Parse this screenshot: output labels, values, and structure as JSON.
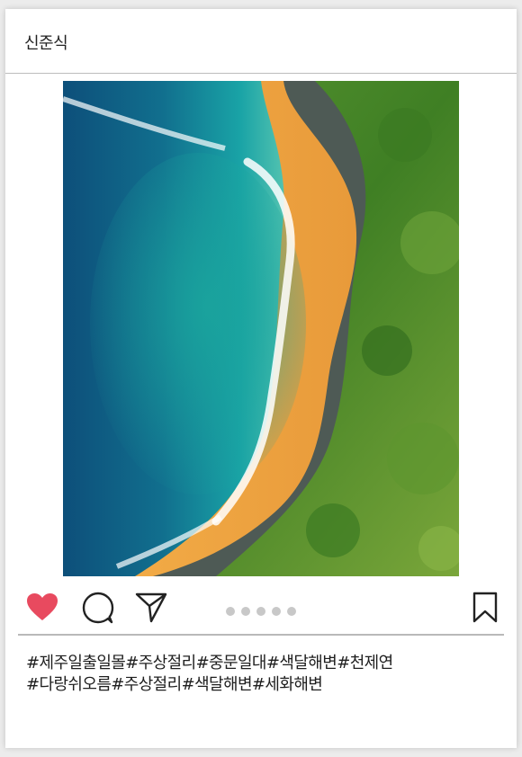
{
  "post": {
    "username": "신준식",
    "image_alt": "aerial view of a curved beach with turquoise sea and green forest",
    "carousel_dots": 5,
    "caption_lines": [
      "#제주일출일몰#주상절리#중문일대#색달해변#천제연",
      "#다랑쉬오름#주상절리#색달해변#세화해변"
    ]
  },
  "icons": {
    "like": "heart-icon",
    "comment": "comment-icon",
    "share": "send-icon",
    "save": "bookmark-icon"
  },
  "colors": {
    "heart": "#e84a5f",
    "icon_stroke": "#222222",
    "dot": "#c8c8c8"
  }
}
